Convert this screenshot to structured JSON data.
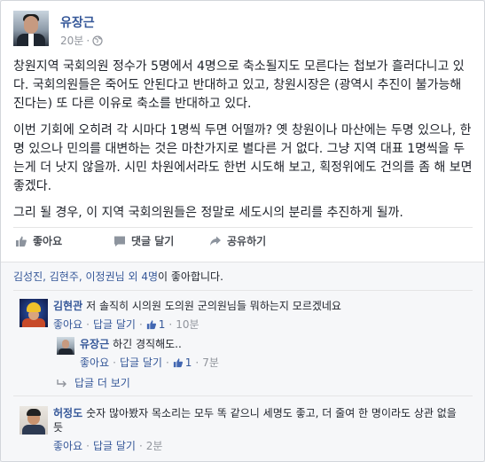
{
  "post": {
    "author": "유장근",
    "timestamp": "20분",
    "paragraphs": [
      "창원지역 국회의원 정수가 5명에서 4명으로 축소될지도 모른다는 첩보가 흘러다니고 있다. 국회의원들은 죽어도 안된다고 반대하고 있고, 창원시장은 (광역시 추진이 불가능해진다는) 또 다른 이유로 축소를 반대하고 있다.",
      "이번 기회에 오히려 각 시마다 1명씩 두면 어떨까? 옛 창원이나 마산에는 두명 있으나, 한명 있으나 민의를 대변하는 것은 마찬가지로 별다른 거 없다. 그냥 지역 대표 1명씩을 두는게 더 낫지 않을까. 시민 차원에서라도 한번 시도해 보고, 획정위에도 건의를 좀 해 보면 좋겠다.",
      "그리 될 경우, 이 지역 국회의원들은 정말로 세도시의 분리를 추진하게 될까."
    ]
  },
  "actions": {
    "like": "좋아요",
    "comment": "댓글 달기",
    "share": "공유하기"
  },
  "likes_summary": {
    "names": "김성진, 김현주, 이정권님 외 4명",
    "suffix": "이 좋아합니다."
  },
  "comments": [
    {
      "author": "김현관",
      "text": "저 솔직히 시의원 도의원 군의원님들 뭐하는지 모르겠네요",
      "like_label": "좋아요",
      "reply_label": "답글 달기",
      "like_count": "1",
      "time": "10분"
    },
    {
      "author": "유장근",
      "text": "하긴 경직해도..",
      "like_label": "좋아요",
      "reply_label": "답글 달기",
      "like_count": "1",
      "time": "7분"
    },
    {
      "author": "허정도",
      "text": "숫자 많아봤자 목소리는 모두 똑 같으니 세명도 좋고, 더 줄여 한 명이라도 상관 없을듯",
      "like_label": "좋아요",
      "reply_label": "답글 달기",
      "time": "2분"
    }
  ],
  "more_replies": "답글 더 보기",
  "colors": {
    "link": "#365899",
    "meta": "#90949c",
    "text": "#1d2129"
  }
}
